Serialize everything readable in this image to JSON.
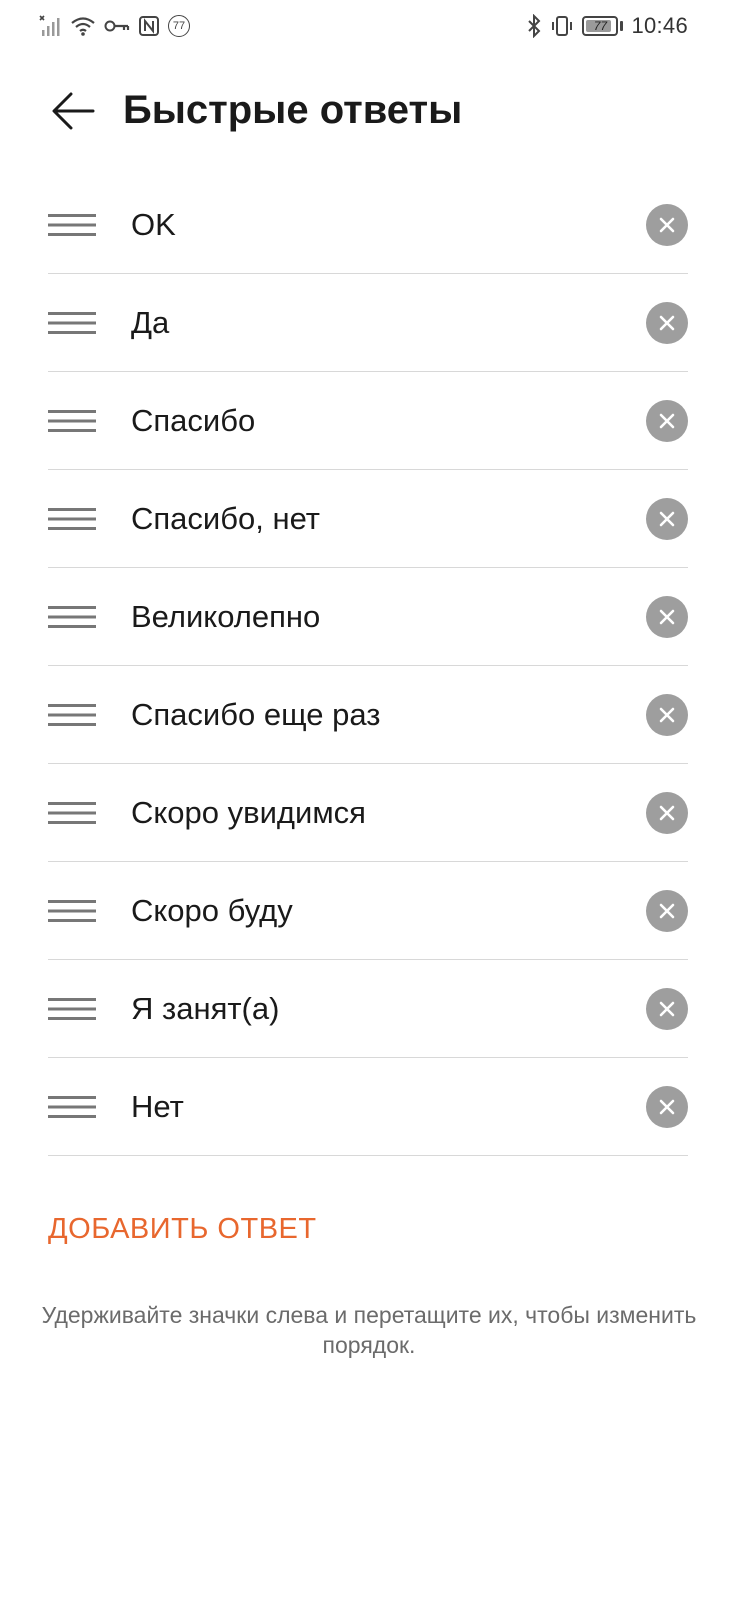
{
  "status_bar": {
    "time": "10:46",
    "battery_level": "77",
    "notification_count": "77",
    "icons": [
      "signal-icon",
      "wifi-icon",
      "vpn-key-icon",
      "nfc-icon",
      "notification-badge",
      "bluetooth-icon",
      "vibrate-icon",
      "battery-icon"
    ]
  },
  "header": {
    "title": "Быстрые ответы",
    "back_icon": "arrow-left-icon"
  },
  "replies": [
    {
      "text": "OK"
    },
    {
      "text": "Да"
    },
    {
      "text": "Спасибо"
    },
    {
      "text": "Спасибо, нет"
    },
    {
      "text": "Великолепно"
    },
    {
      "text": "Спасибо еще раз"
    },
    {
      "text": "Скоро увидимся"
    },
    {
      "text": "Скоро буду"
    },
    {
      "text": "Я занят(а)"
    },
    {
      "text": "Нет"
    }
  ],
  "add_button_label": "ДОБАВИТЬ ОТВЕТ",
  "hint_text": "Удерживайте значки слева и перетащите их, чтобы изменить порядок.",
  "colors": {
    "accent": "#e8672e",
    "delete_bg": "#9e9e9e",
    "divider": "#d8d8d8",
    "hint": "#6b6b6b"
  }
}
